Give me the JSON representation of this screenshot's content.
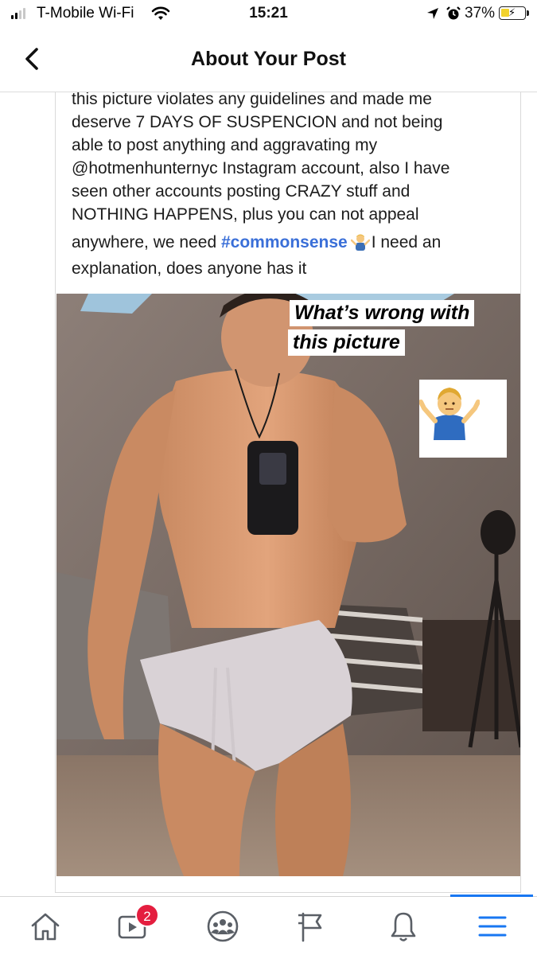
{
  "status_bar": {
    "carrier": "T-Mobile Wi-Fi",
    "time": "15:21",
    "battery_percent": "37%",
    "battery_level": 0.37,
    "signal_bars": 2
  },
  "header": {
    "title": "About Your Post",
    "back_icon": "chevron-left-icon"
  },
  "post": {
    "lines": [
      "this picture violates any guidelines and made me",
      "deserve 7 DAYS OF SUSPENCION and not being",
      "able to post anything and aggravating my",
      "@hotmenhunternyc Instagram account, also I have",
      "seen other accounts posting CRAZY stuff and",
      "NOTHING HAPPENS, plus you can not appeal"
    ],
    "line7_prefix": "anywhere, we need ",
    "hashtag": "#commonsense",
    "line7_suffix": "I need an",
    "line8": "explanation, does anyone has it",
    "image": {
      "caption_line1": "What’s wrong with",
      "caption_line2": "this picture",
      "sticker": "person-shrugging-emoji"
    }
  },
  "tab_bar": {
    "tabs": [
      "home-icon",
      "watch-icon",
      "groups-icon",
      "pages-flag-icon",
      "notifications-bell-icon",
      "menu-icon"
    ],
    "watch_badge": "2",
    "active_tab": "menu",
    "accent_color": "#1877f2",
    "badge_color": "#e41e3f"
  }
}
